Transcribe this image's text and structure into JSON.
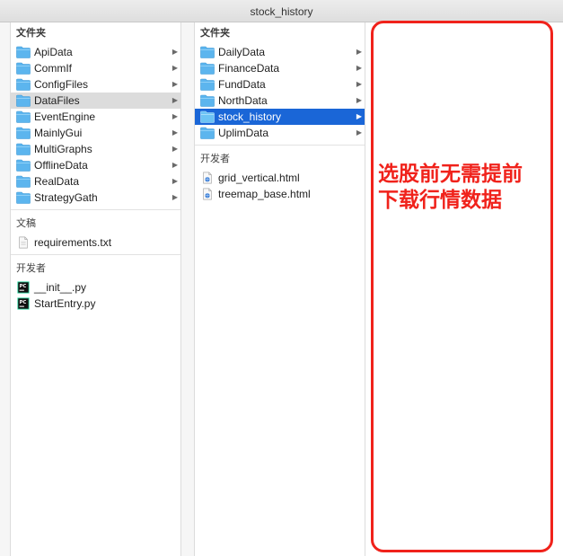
{
  "window": {
    "title": "stock_history"
  },
  "column1": {
    "folders_header": "文件夹",
    "folders": [
      {
        "label": "ApiData"
      },
      {
        "label": "CommIf"
      },
      {
        "label": "ConfigFiles"
      },
      {
        "label": "DataFiles",
        "selected": true
      },
      {
        "label": "EventEngine"
      },
      {
        "label": "MainlyGui"
      },
      {
        "label": "MultiGraphs"
      },
      {
        "label": "OfflineData"
      },
      {
        "label": "RealData"
      },
      {
        "label": "StrategyGath"
      }
    ],
    "documents_header": "文稿",
    "documents": [
      {
        "label": "requirements.txt"
      }
    ],
    "developer_header": "开发者",
    "developer": [
      {
        "label": "__init__.py"
      },
      {
        "label": "StartEntry.py"
      }
    ]
  },
  "column2": {
    "folders_header": "文件夹",
    "folders": [
      {
        "label": "DailyData"
      },
      {
        "label": "FinanceData"
      },
      {
        "label": "FundData"
      },
      {
        "label": "NorthData"
      },
      {
        "label": "stock_history",
        "selected": true
      },
      {
        "label": "UplimData"
      }
    ],
    "developer_header": "开发者",
    "developer": [
      {
        "label": "grid_vertical.html"
      },
      {
        "label": "treemap_base.html"
      }
    ]
  },
  "annotation": {
    "line1": "选股前无需提前",
    "line2": "下载行情数据",
    "color": "#f0221b"
  },
  "colors": {
    "selection_blue": "#1a66d7",
    "selection_gray": "#dcdcdc",
    "folder_blue": "#5cb5ee"
  }
}
